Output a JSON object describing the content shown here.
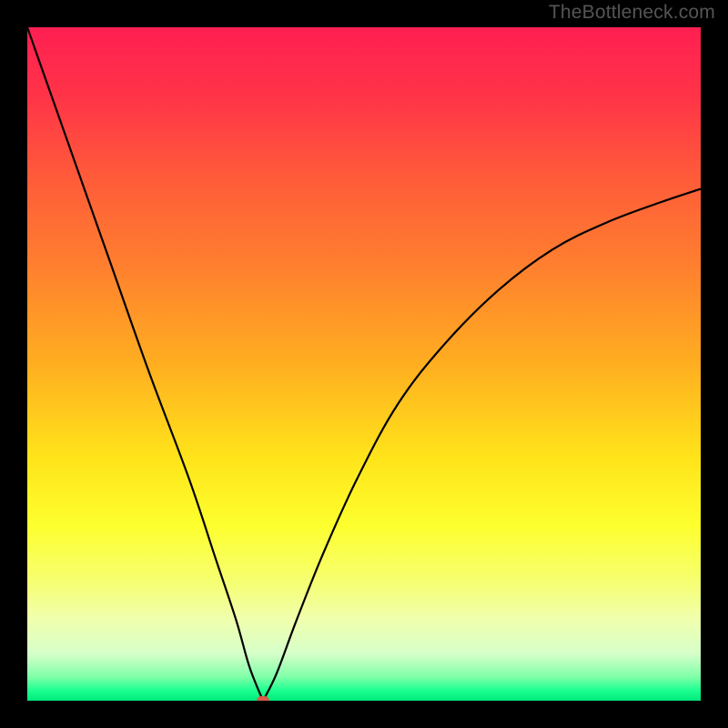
{
  "watermark": "TheBottleneck.com",
  "chart_data": {
    "type": "line",
    "title": "",
    "xlabel": "",
    "ylabel": "",
    "xlim": [
      0,
      100
    ],
    "ylim": [
      0,
      100
    ],
    "notch": {
      "x": 35,
      "y": 0
    },
    "left_curve": [
      {
        "x": 0,
        "y": 100
      },
      {
        "x": 6,
        "y": 83
      },
      {
        "x": 12,
        "y": 66
      },
      {
        "x": 18,
        "y": 49
      },
      {
        "x": 24,
        "y": 33
      },
      {
        "x": 28,
        "y": 21
      },
      {
        "x": 31,
        "y": 12
      },
      {
        "x": 33,
        "y": 5
      },
      {
        "x": 35,
        "y": 0
      }
    ],
    "right_curve": [
      {
        "x": 35,
        "y": 0
      },
      {
        "x": 37,
        "y": 4
      },
      {
        "x": 40,
        "y": 12
      },
      {
        "x": 44,
        "y": 22
      },
      {
        "x": 49,
        "y": 33
      },
      {
        "x": 55,
        "y": 44
      },
      {
        "x": 62,
        "y": 53
      },
      {
        "x": 70,
        "y": 61
      },
      {
        "x": 78,
        "y": 67
      },
      {
        "x": 86,
        "y": 71
      },
      {
        "x": 94,
        "y": 74
      },
      {
        "x": 100,
        "y": 76
      }
    ],
    "marker": {
      "x": 35,
      "y": 0,
      "color": "#d95a4a"
    },
    "gradient_stops": [
      {
        "offset": 0.0,
        "color": "#ff1f52"
      },
      {
        "offset": 0.1,
        "color": "#ff3348"
      },
      {
        "offset": 0.22,
        "color": "#ff5a3a"
      },
      {
        "offset": 0.35,
        "color": "#ff7e2f"
      },
      {
        "offset": 0.5,
        "color": "#ffae20"
      },
      {
        "offset": 0.64,
        "color": "#ffe41a"
      },
      {
        "offset": 0.74,
        "color": "#fdff2e"
      },
      {
        "offset": 0.82,
        "color": "#f6ff6e"
      },
      {
        "offset": 0.88,
        "color": "#f0ffae"
      },
      {
        "offset": 0.93,
        "color": "#d6ffc9"
      },
      {
        "offset": 0.965,
        "color": "#7effa8"
      },
      {
        "offset": 0.985,
        "color": "#1bff90"
      },
      {
        "offset": 1.0,
        "color": "#00e87b"
      }
    ]
  }
}
